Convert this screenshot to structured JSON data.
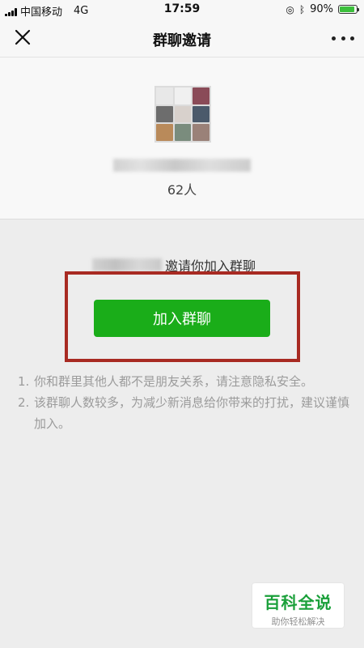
{
  "status_bar": {
    "carrier": "中国移动",
    "network": "4G",
    "time": "17:59",
    "battery": "90%",
    "battery_level": 0.9
  },
  "nav": {
    "title": "群聊邀请"
  },
  "group": {
    "member_count": "62人",
    "avatar_colors": [
      "#e8e8e8",
      "#f0f0f0",
      "#8a4b58",
      "#6d6d6d",
      "#d8d1cc",
      "#4b5a6b",
      "#b98a5a",
      "#7a8c7d",
      "#9a8178"
    ]
  },
  "invite": {
    "message": "邀请你加入群聊"
  },
  "actions": {
    "join_label": "加入群聊"
  },
  "notes": [
    {
      "num": "1.",
      "text": "你和群里其他人都不是朋友关系，请注意隐私安全。"
    },
    {
      "num": "2.",
      "text": "该群聊人数较多，为减少新消息给你带来的打扰，建议谨慎加入。"
    }
  ],
  "watermark": {
    "title": "百科全说",
    "subtitle": "助你轻松解决"
  },
  "colors": {
    "accent_green": "#1aad19",
    "highlight_red": "#a82a22"
  }
}
